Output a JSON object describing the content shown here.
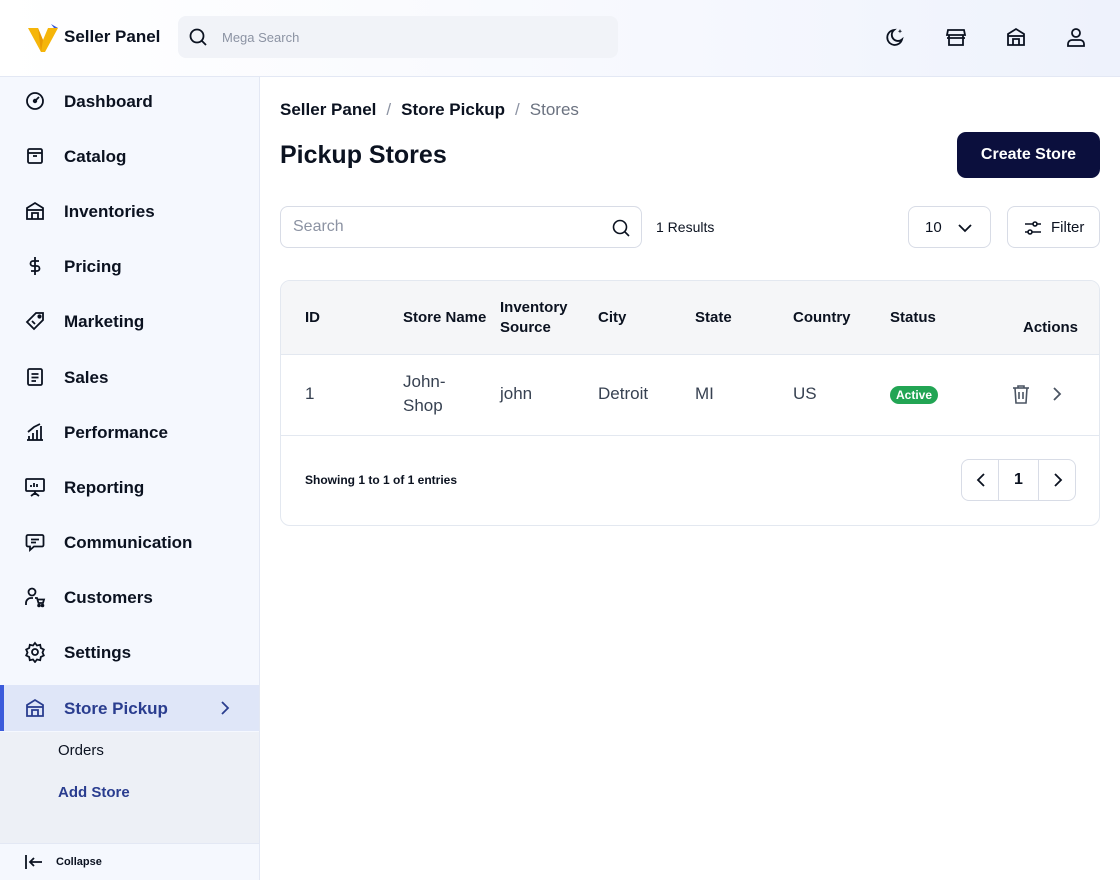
{
  "header": {
    "brand": "Seller Panel",
    "search_placeholder": "Mega Search",
    "icons": [
      "moon-icon",
      "storefront-icon",
      "store-icon",
      "user-icon"
    ]
  },
  "sidebar": {
    "items": [
      {
        "label": "Dashboard",
        "icon": "dashboard-icon"
      },
      {
        "label": "Catalog",
        "icon": "catalog-icon"
      },
      {
        "label": "Inventories",
        "icon": "warehouse-icon"
      },
      {
        "label": "Pricing",
        "icon": "dollar-icon"
      },
      {
        "label": "Marketing",
        "icon": "tag-icon"
      },
      {
        "label": "Sales",
        "icon": "document-icon"
      },
      {
        "label": "Performance",
        "icon": "bar-chart-icon"
      },
      {
        "label": "Reporting",
        "icon": "presentation-icon"
      },
      {
        "label": "Communication",
        "icon": "chat-icon"
      },
      {
        "label": "Customers",
        "icon": "customer-cart-icon"
      },
      {
        "label": "Settings",
        "icon": "gear-icon"
      },
      {
        "label": "Store Pickup",
        "icon": "store-icon",
        "active": true
      }
    ],
    "submenu": [
      {
        "label": "Orders"
      },
      {
        "label": "Add Store",
        "active": true
      }
    ],
    "collapse_label": "Collapse"
  },
  "main": {
    "breadcrumb": [
      "Seller Panel",
      "Store Pickup",
      "Stores"
    ],
    "title": "Pickup Stores",
    "create_button": "Create Store",
    "search_placeholder": "Search",
    "results_text": "1 Results",
    "per_page": "10",
    "filter_label": "Filter",
    "table": {
      "columns": [
        "ID",
        "Store Name",
        "Inventory Source",
        "City",
        "State",
        "Country",
        "Status",
        "Actions"
      ],
      "rows": [
        {
          "id": "1",
          "store_name": "John-Shop",
          "inventory_source": "john",
          "city": "Detroit",
          "state": "MI",
          "country": "US",
          "status": "Active"
        }
      ]
    },
    "showing_text": "Showing 1 to 1 of 1 entries",
    "current_page": "1"
  },
  "colors": {
    "primary_button": "#0b0f3d",
    "active_nav": "#2a3d8f",
    "status_active": "#22a554",
    "logo_yellow": "#f5b50a",
    "logo_blue": "#3b5bdb"
  }
}
